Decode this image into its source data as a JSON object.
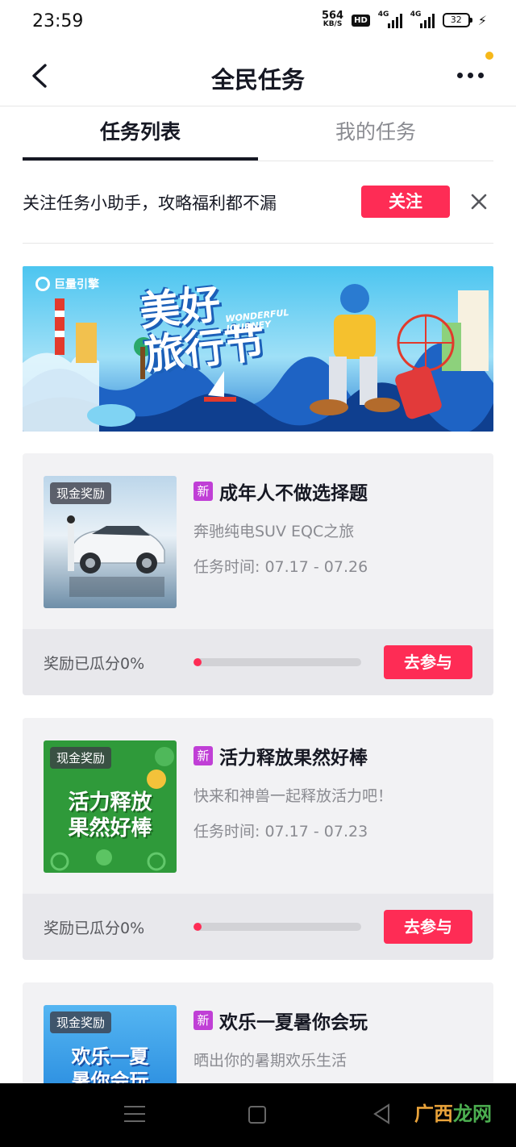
{
  "status_bar": {
    "time": "23:59",
    "net_speed_value": "564",
    "net_speed_unit": "KB/S",
    "hd_label": "HD",
    "signal1_label": "4G",
    "signal2_label": "4G",
    "battery_level": "32"
  },
  "header": {
    "title": "全民任务",
    "back_icon": "chevron-left-icon",
    "more_icon": "more-dots-icon",
    "notification_dot_color": "#f6b81a"
  },
  "tabs": [
    {
      "label": "任务列表",
      "active": true
    },
    {
      "label": "我的任务",
      "active": false
    }
  ],
  "follow_bar": {
    "text": "关注任务小助手，攻略福利都不漏",
    "button": "关注",
    "close_icon": "close-icon"
  },
  "banner": {
    "brand": "巨量引擎",
    "title_line1": "美好",
    "title_line2": "旅行节",
    "sub_line1": "WONDERFUL",
    "sub_line2": "JOURNEY"
  },
  "tasks": [
    {
      "tag": "现金奖励",
      "badge": "新",
      "title": "成年人不做选择题",
      "desc": "奔驰纯电SUV EQC之旅",
      "time": "任务时间: 07.17 - 07.26",
      "reward_text": "奖励已瓜分0%",
      "progress": 0,
      "button": "去参与"
    },
    {
      "tag": "现金奖励",
      "badge": "新",
      "title": "活力释放果然好棒",
      "desc": "快来和神兽一起释放活力吧！",
      "time": "任务时间: 07.17 - 07.23",
      "reward_text": "奖励已瓜分0%",
      "progress": 0,
      "button": "去参与",
      "thumb_line1": "活力释放",
      "thumb_line2": "果然好棒"
    },
    {
      "tag": "现金奖励",
      "badge": "新",
      "title": "欢乐一夏暑你会玩",
      "desc": "晒出你的暑期欢乐生活",
      "thumb_line1": "欢乐一夏",
      "thumb_line2": "暑你会玩"
    }
  ],
  "colors": {
    "accent": "#fe2c55",
    "new_badge": "#c03fd6"
  },
  "watermark": {
    "part1": "广西",
    "part2": "龙网"
  }
}
